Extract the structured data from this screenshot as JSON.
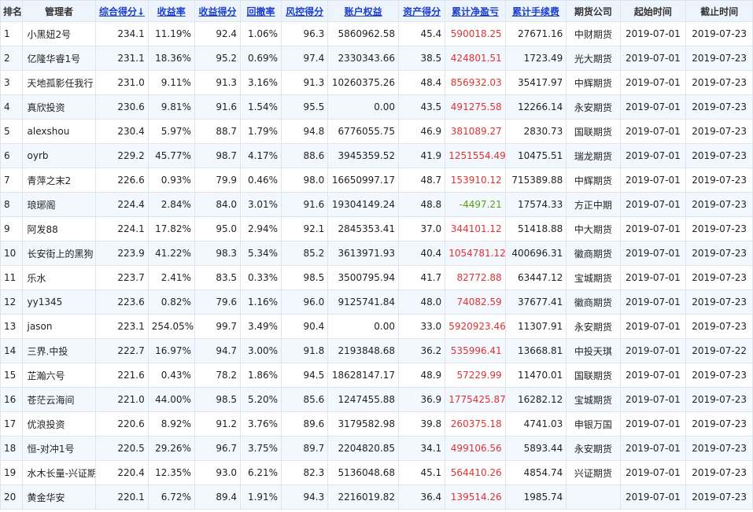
{
  "colors": {
    "header_bg": "#eef4fc",
    "link_blue": "#1a3fd0",
    "red": "#e03232",
    "green": "#5aa00a",
    "row_alt": "#f3f8ff"
  },
  "headers": {
    "rank": "排名",
    "manager": "管理者",
    "composite": "综合得分↓",
    "return_rate": "收益率",
    "return_score": "收益得分",
    "drawdown": "回撤率",
    "risk_score": "风控得分",
    "equity": "账户权益",
    "asset_score": "资产得分",
    "net_pnl": "累计净盈亏",
    "fees": "累计手续费",
    "company": "期货公司",
    "start": "起始时间",
    "end": "截止时间"
  },
  "rows": [
    {
      "rank": "1",
      "manager": "小黑妞2号",
      "composite": "234.1",
      "return_rate": "11.19%",
      "return_score": "92.4",
      "drawdown": "1.06%",
      "risk_score": "96.3",
      "equity": "5860962.58",
      "asset_score": "45.4",
      "net_pnl": "590018.25",
      "pnl_sign": "neg",
      "fees": "27671.16",
      "company": "中财期货",
      "start": "2019-07-01",
      "end": "2019-07-23"
    },
    {
      "rank": "2",
      "manager": "亿隆华睿1号",
      "composite": "231.1",
      "return_rate": "18.36%",
      "return_score": "95.2",
      "drawdown": "0.69%",
      "risk_score": "97.4",
      "equity": "2330343.66",
      "asset_score": "38.5",
      "net_pnl": "424801.51",
      "pnl_sign": "neg",
      "fees": "1723.49",
      "company": "光大期货",
      "start": "2019-07-01",
      "end": "2019-07-23"
    },
    {
      "rank": "3",
      "manager": "天地孤影任我行",
      "composite": "231.0",
      "return_rate": "9.11%",
      "return_score": "91.3",
      "drawdown": "3.16%",
      "risk_score": "91.3",
      "equity": "10260375.26",
      "asset_score": "48.4",
      "net_pnl": "856932.03",
      "pnl_sign": "neg",
      "fees": "35417.97",
      "company": "中辉期货",
      "start": "2019-07-01",
      "end": "2019-07-23"
    },
    {
      "rank": "4",
      "manager": "真欣投资",
      "composite": "230.6",
      "return_rate": "9.81%",
      "return_score": "91.6",
      "drawdown": "1.54%",
      "risk_score": "95.5",
      "equity": "0.00",
      "asset_score": "43.5",
      "net_pnl": "491275.58",
      "pnl_sign": "neg",
      "fees": "12266.14",
      "company": "永安期货",
      "start": "2019-07-01",
      "end": "2019-07-23"
    },
    {
      "rank": "5",
      "manager": "alexshou",
      "composite": "230.4",
      "return_rate": "5.97%",
      "return_score": "88.7",
      "drawdown": "1.79%",
      "risk_score": "94.8",
      "equity": "6776055.75",
      "asset_score": "46.9",
      "net_pnl": "381089.27",
      "pnl_sign": "neg",
      "fees": "2830.73",
      "company": "国联期货",
      "start": "2019-07-01",
      "end": "2019-07-23"
    },
    {
      "rank": "6",
      "manager": "oyrb",
      "composite": "229.2",
      "return_rate": "45.77%",
      "return_score": "98.7",
      "drawdown": "4.17%",
      "risk_score": "88.6",
      "equity": "3945359.52",
      "asset_score": "41.9",
      "net_pnl": "1251554.49",
      "pnl_sign": "neg",
      "fees": "10475.51",
      "company": "瑞龙期货",
      "start": "2019-07-01",
      "end": "2019-07-23"
    },
    {
      "rank": "7",
      "manager": "青萍之末2",
      "composite": "226.6",
      "return_rate": "0.93%",
      "return_score": "79.9",
      "drawdown": "0.46%",
      "risk_score": "98.0",
      "equity": "16650997.17",
      "asset_score": "48.7",
      "net_pnl": "153910.12",
      "pnl_sign": "neg",
      "fees": "715389.88",
      "company": "中辉期货",
      "start": "2019-07-01",
      "end": "2019-07-23"
    },
    {
      "rank": "8",
      "manager": "琅琊阁",
      "composite": "224.4",
      "return_rate": "2.84%",
      "return_score": "84.0",
      "drawdown": "3.01%",
      "risk_score": "91.6",
      "equity": "19304149.24",
      "asset_score": "48.8",
      "net_pnl": "-4497.21",
      "pnl_sign": "pos",
      "fees": "17574.33",
      "company": "方正中期",
      "start": "2019-07-01",
      "end": "2019-07-23"
    },
    {
      "rank": "9",
      "manager": "阿发88",
      "composite": "224.1",
      "return_rate": "17.82%",
      "return_score": "95.0",
      "drawdown": "2.94%",
      "risk_score": "92.1",
      "equity": "2845353.41",
      "asset_score": "37.0",
      "net_pnl": "344101.12",
      "pnl_sign": "neg",
      "fees": "51418.88",
      "company": "中大期货",
      "start": "2019-07-01",
      "end": "2019-07-23"
    },
    {
      "rank": "10",
      "manager": "长安街上的黑狗",
      "composite": "223.9",
      "return_rate": "41.22%",
      "return_score": "98.3",
      "drawdown": "5.34%",
      "risk_score": "85.2",
      "equity": "3613971.93",
      "asset_score": "40.4",
      "net_pnl": "1054781.12",
      "pnl_sign": "neg",
      "fees": "400696.31",
      "company": "徽商期货",
      "start": "2019-07-01",
      "end": "2019-07-23"
    },
    {
      "rank": "11",
      "manager": "乐水",
      "composite": "223.7",
      "return_rate": "2.41%",
      "return_score": "83.5",
      "drawdown": "0.33%",
      "risk_score": "98.5",
      "equity": "3500795.94",
      "asset_score": "41.7",
      "net_pnl": "82772.88",
      "pnl_sign": "neg",
      "fees": "63447.12",
      "company": "宝城期货",
      "start": "2019-07-01",
      "end": "2019-07-23"
    },
    {
      "rank": "12",
      "manager": "yy1345",
      "composite": "223.6",
      "return_rate": "0.82%",
      "return_score": "79.6",
      "drawdown": "1.16%",
      "risk_score": "96.0",
      "equity": "9125741.84",
      "asset_score": "48.0",
      "net_pnl": "74082.59",
      "pnl_sign": "neg",
      "fees": "37677.41",
      "company": "徽商期货",
      "start": "2019-07-01",
      "end": "2019-07-23"
    },
    {
      "rank": "13",
      "manager": "jason",
      "composite": "223.1",
      "return_rate": "254.05%",
      "return_score": "99.7",
      "drawdown": "3.49%",
      "risk_score": "90.4",
      "equity": "0.00",
      "asset_score": "33.0",
      "net_pnl": "5920923.46",
      "pnl_sign": "neg",
      "fees": "11307.91",
      "company": "永安期货",
      "start": "2019-07-01",
      "end": "2019-07-23"
    },
    {
      "rank": "14",
      "manager": "三界.中投",
      "composite": "222.7",
      "return_rate": "16.97%",
      "return_score": "94.7",
      "drawdown": "3.00%",
      "risk_score": "91.8",
      "equity": "2193848.68",
      "asset_score": "36.2",
      "net_pnl": "535996.41",
      "pnl_sign": "neg",
      "fees": "13668.81",
      "company": "中投天琪",
      "start": "2019-07-01",
      "end": "2019-07-22"
    },
    {
      "rank": "15",
      "manager": "芷瀚六号",
      "composite": "221.6",
      "return_rate": "0.43%",
      "return_score": "78.2",
      "drawdown": "1.86%",
      "risk_score": "94.5",
      "equity": "18628147.17",
      "asset_score": "48.9",
      "net_pnl": "57229.99",
      "pnl_sign": "neg",
      "fees": "11470.01",
      "company": "国联期货",
      "start": "2019-07-01",
      "end": "2019-07-23"
    },
    {
      "rank": "16",
      "manager": "苍茫云海间",
      "composite": "221.0",
      "return_rate": "44.00%",
      "return_score": "98.5",
      "drawdown": "5.20%",
      "risk_score": "85.6",
      "equity": "1247455.88",
      "asset_score": "36.9",
      "net_pnl": "1775425.87",
      "pnl_sign": "neg",
      "fees": "16282.12",
      "company": "宝城期货",
      "start": "2019-07-01",
      "end": "2019-07-23"
    },
    {
      "rank": "17",
      "manager": "优浪投资",
      "composite": "220.6",
      "return_rate": "8.92%",
      "return_score": "91.2",
      "drawdown": "3.76%",
      "risk_score": "89.6",
      "equity": "3179582.98",
      "asset_score": "39.8",
      "net_pnl": "260375.18",
      "pnl_sign": "neg",
      "fees": "4741.03",
      "company": "申银万国",
      "start": "2019-07-01",
      "end": "2019-07-23"
    },
    {
      "rank": "18",
      "manager": "恒-对冲1号",
      "composite": "220.5",
      "return_rate": "29.26%",
      "return_score": "96.7",
      "drawdown": "3.75%",
      "risk_score": "89.7",
      "equity": "2204820.85",
      "asset_score": "34.1",
      "net_pnl": "499106.56",
      "pnl_sign": "neg",
      "fees": "5893.44",
      "company": "永安期货",
      "start": "2019-07-01",
      "end": "2019-07-23"
    },
    {
      "rank": "19",
      "manager": "水木长量-兴证期",
      "composite": "220.4",
      "return_rate": "12.35%",
      "return_score": "93.0",
      "drawdown": "6.21%",
      "risk_score": "82.3",
      "equity": "5136048.68",
      "asset_score": "45.1",
      "net_pnl": "564410.26",
      "pnl_sign": "neg",
      "fees": "4854.74",
      "company": "兴证期货",
      "start": "2019-07-01",
      "end": "2019-07-23"
    },
    {
      "rank": "20",
      "manager": "黄金华安",
      "composite": "220.1",
      "return_rate": "6.72%",
      "return_score": "89.4",
      "drawdown": "1.91%",
      "risk_score": "94.3",
      "equity": "2216019.82",
      "asset_score": "36.4",
      "net_pnl": "139514.26",
      "pnl_sign": "neg",
      "fees": "1985.74",
      "company": "",
      "start": "2019-07-01",
      "end": "2019-07-23"
    }
  ]
}
